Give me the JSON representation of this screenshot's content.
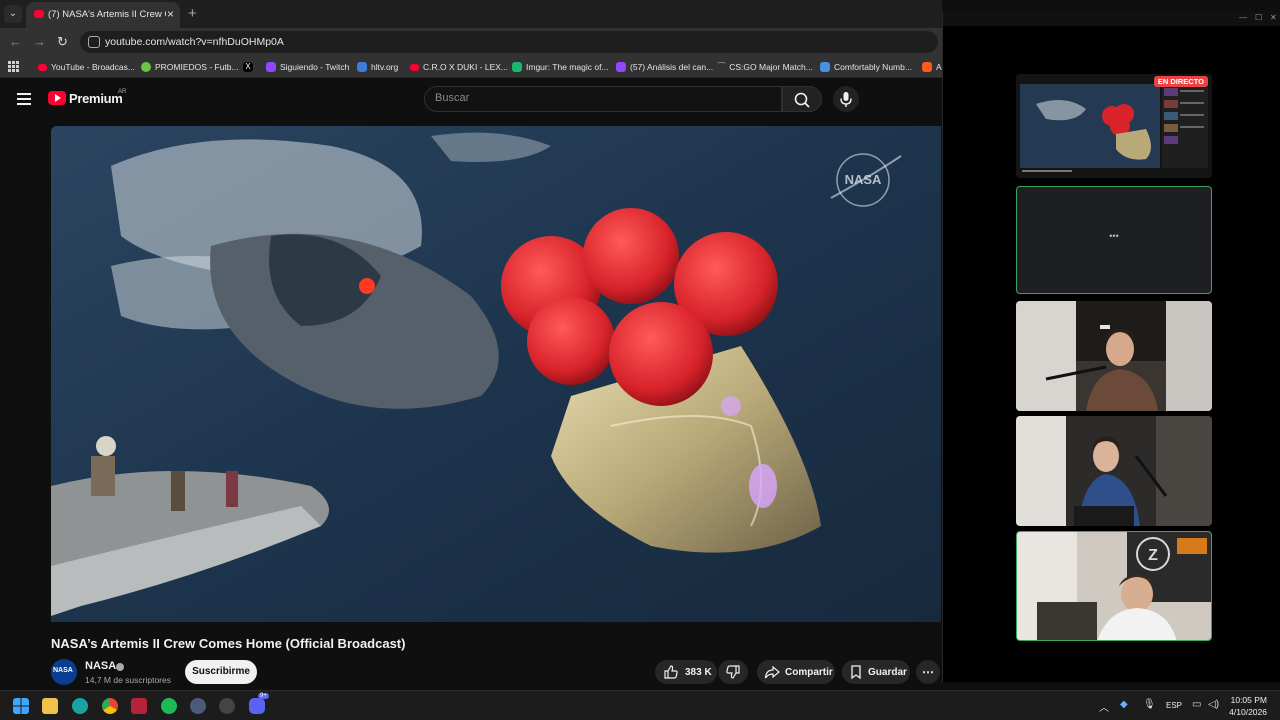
{
  "browser": {
    "active_tab": {
      "title": "(7) NASA's Artemis II Crew Com"
    },
    "url": "youtube.com/watch?v=nfhDuOHMp0A",
    "bookmarks": [
      "YouTube - Broadcas...",
      "PROMIEDOS - Futb...",
      "Siguiendo - Twitch",
      "hltv.org",
      "C.R.O X DUKI - LEX...",
      "Imgur: The magic of...",
      "(57) Análisis del can...",
      "CS:GO Major Match...",
      "Comfortably Numb...",
      "A"
    ],
    "bookmark_colors": [
      "#ff0033",
      "#6cc644",
      "#000000",
      "#9146ff",
      "#3b7dd8",
      "#ff0033",
      "#1bb76e",
      "#9146ff",
      "#888888",
      "#4a90e2",
      "#ff5a1f"
    ]
  },
  "youtube": {
    "logo_text": "Premium",
    "country_code": "AR",
    "search_placeholder": "Buscar",
    "video_title": "NASA’s Artemis II Crew Comes Home (Official Broadcast)",
    "channel_name": "NASA",
    "subscribers": "14,7 M de suscriptores",
    "subscribe_label": "Suscribirme",
    "likes": "383 K",
    "share_label": "Compartir",
    "save_label": "Guardar",
    "watermark": "NASA"
  },
  "discord_popout": {
    "live_badge": "EN DIRECTO",
    "loading_indicator": "•••",
    "accent_color": "#3ba55c"
  },
  "taskbar": {
    "language": "ESP",
    "time": "10:05 PM",
    "date": "4/10/2026",
    "discord_badge": "9+"
  }
}
